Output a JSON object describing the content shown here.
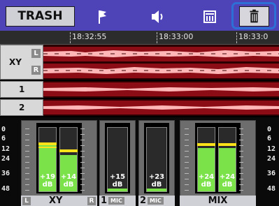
{
  "toolbar": {
    "trash_label": "TRASH",
    "icons": [
      "mark-flag-icon",
      "audio-speaker-icon",
      "meter-view-icon",
      "delete-trash-icon"
    ]
  },
  "timeline": {
    "times": [
      "18:32:55",
      "18:33:00",
      "18:33:0"
    ]
  },
  "tracks": {
    "xy": {
      "name": "XY",
      "left": "L",
      "right": "R"
    },
    "ch1": {
      "name": "1"
    },
    "ch2": {
      "name": "2"
    }
  },
  "scale": {
    "left": [
      "0",
      "6",
      "12",
      "24",
      "36",
      "48"
    ],
    "right": [
      "0",
      "6",
      "12",
      "24",
      "36",
      "48"
    ]
  },
  "meters": {
    "xy": {
      "name": "XY",
      "left_tag": "L",
      "right_tag": "R",
      "l_gain": "+19",
      "r_gain": "+14",
      "unit": "dB"
    },
    "ch1": {
      "name": "1",
      "tag": "MIC",
      "gain": "+15",
      "unit": "dB"
    },
    "ch2": {
      "name": "2",
      "tag": "MIC",
      "gain": "+23",
      "unit": "dB"
    },
    "mix": {
      "name": "MIX",
      "l_gain": "+24",
      "r_gain": "+24",
      "unit": "dB"
    }
  },
  "colors": {
    "toolbar": "#4f43b8",
    "selected_frame": "#2e6fd6",
    "wave_bg": "#8b0c14",
    "wave_fg": "#ffb6b6",
    "meter_green": "#7be24a",
    "peak_yellow": "#ffe21a"
  }
}
